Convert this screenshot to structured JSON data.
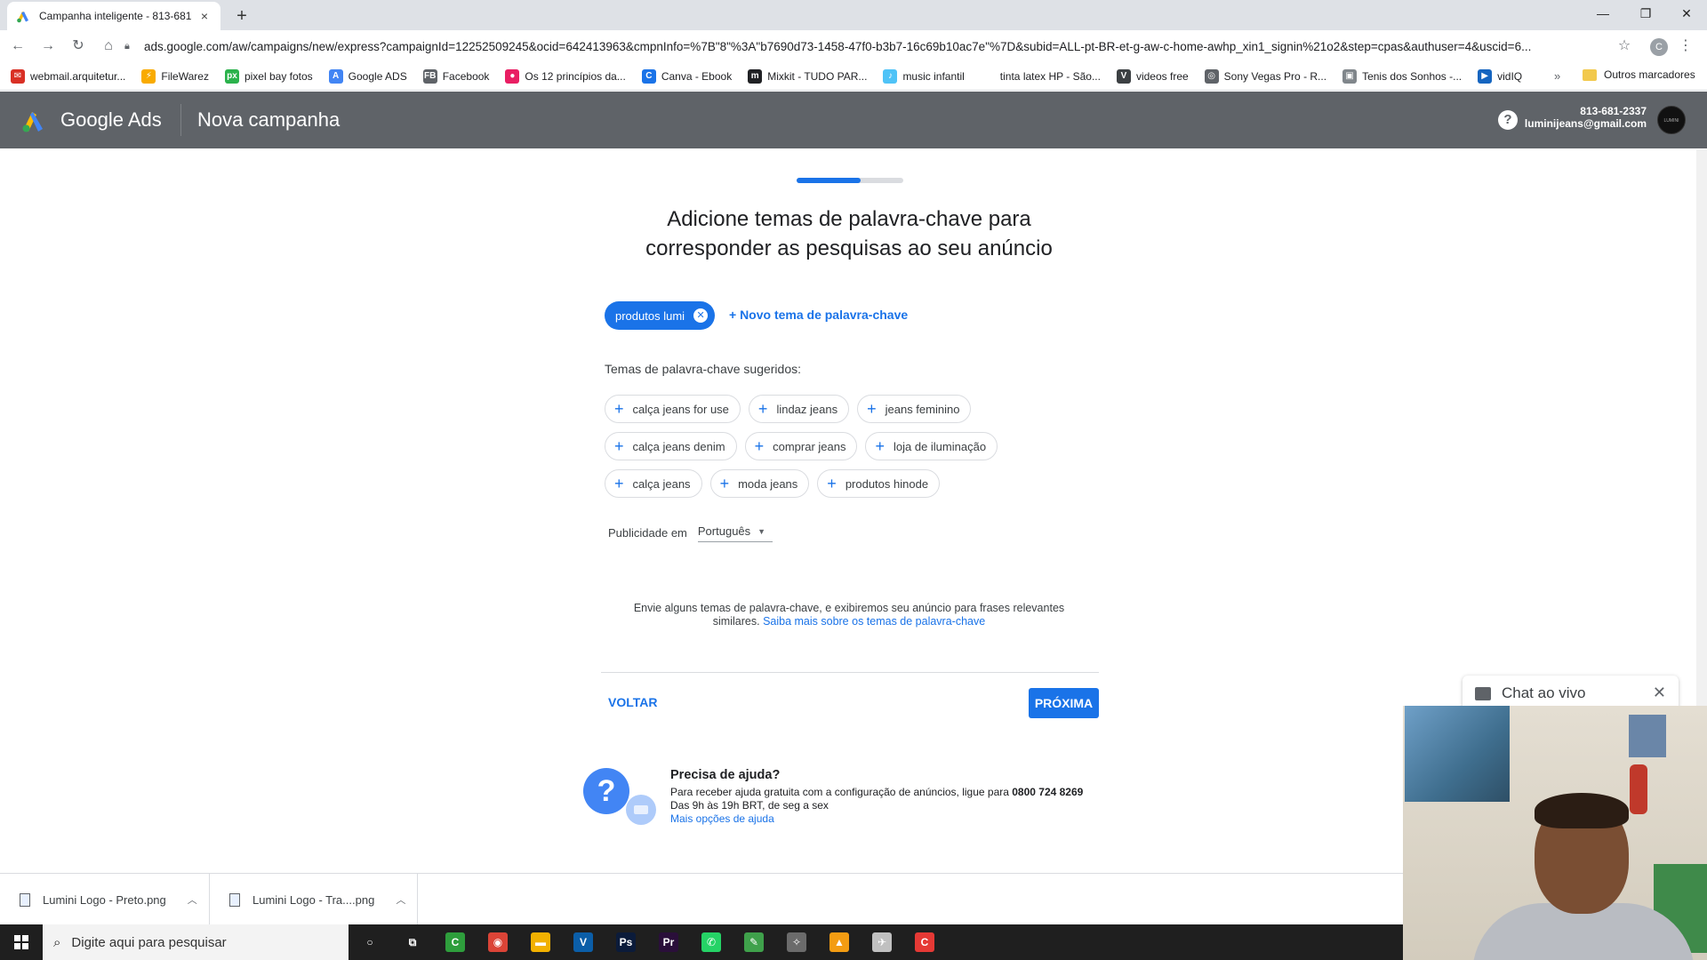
{
  "browser": {
    "tab_title": "Campanha inteligente - 813-681",
    "tab_close": "×",
    "new_tab": "+",
    "url": "ads.google.com/aw/campaigns/new/express?campaignId=12252509245&ocid=642413963&cmpnInfo=%7B\"8\"%3A\"b7690d73-1458-47f0-b3b7-16c69b10ac7e\"%7D&subid=ALL-pt-BR-et-g-aw-c-home-awhp_xin1_signin%21o2&step=cpas&authuser=4&uscid=6...",
    "profile_initial": "C",
    "bookmarks": [
      {
        "label": "webmail.arquitetur...",
        "color": "#d93025",
        "glyph": "✉"
      },
      {
        "label": "FileWarez",
        "color": "#f9ab00",
        "glyph": "⚡"
      },
      {
        "label": "pixel bay fotos",
        "color": "#2bb24c",
        "glyph": "px"
      },
      {
        "label": "Google ADS",
        "color": "#4285f4",
        "glyph": "A"
      },
      {
        "label": "Facebook",
        "color": "#5f6368",
        "glyph": "FB"
      },
      {
        "label": "Os 12 princípios da...",
        "color": "#e91e63",
        "glyph": "●"
      },
      {
        "label": "Canva - Ebook",
        "color": "#1a73e8",
        "glyph": "C"
      },
      {
        "label": "Mixkit - TUDO PAR...",
        "color": "#202124",
        "glyph": "m"
      },
      {
        "label": "music infantil",
        "color": "#4fc3f7",
        "glyph": "♪"
      },
      {
        "label": "tinta latex HP - São...",
        "color": "#ffffff",
        "glyph": ""
      },
      {
        "label": "videos free",
        "color": "#3c4043",
        "glyph": "V"
      },
      {
        "label": "Sony Vegas Pro - R...",
        "color": "#5f6368",
        "glyph": "◎"
      },
      {
        "label": "Tenis dos Sonhos -...",
        "color": "#80868b",
        "glyph": "▣"
      },
      {
        "label": "vidIQ",
        "color": "#1565c0",
        "glyph": "▶"
      }
    ],
    "bookmarks_more": "»",
    "bookmarks_other": "Outros marcadores"
  },
  "header": {
    "product": "Google Ads",
    "page": "Nova campanha",
    "help": "?",
    "account_id": "813-681-2337",
    "account_email": "luminijeans@gmail.com",
    "avatar_text": "LUMINI"
  },
  "wizard": {
    "progress_fraction": 0.6,
    "headline_1": "Adicione temas de palavra-chave para",
    "headline_2": "corresponder as pesquisas ao seu anúncio",
    "selected_theme": "produtos lumi",
    "add_theme": "+ Novo tema de palavra-chave",
    "suggested_label": "Temas de palavra-chave sugeridos:",
    "suggestions": [
      [
        "calça jeans for use",
        "lindaz jeans",
        "jeans feminino"
      ],
      [
        "calça jeans denim",
        "comprar jeans",
        "loja de iluminação"
      ],
      [
        "calça jeans",
        "moda jeans",
        "produtos hinode"
      ]
    ],
    "language_label": "Publicidade em",
    "language_value": "Português",
    "info_text": "Envie alguns temas de palavra-chave, e exibiremos seu anúncio para frases relevantes similares.",
    "info_link": "Saiba mais sobre os temas de palavra-chave",
    "back": "VOLTAR",
    "next": "PRÓXIMA"
  },
  "help": {
    "title": "Precisa de ajuda?",
    "line1": "Para receber ajuda gratuita com a configuração de anúncios, ligue para",
    "phone": "0800 724 8269",
    "line2": "Das 9h às 19h BRT, de seg a sex",
    "link": "Mais opções de ajuda"
  },
  "chat": {
    "label": "Chat ao vivo",
    "close": "✕"
  },
  "downloads": [
    {
      "name": "Lumini Logo - Preto.png"
    },
    {
      "name": "Lumini Logo - Tra....png"
    }
  ],
  "taskbar": {
    "search_placeholder": "Digite aqui para pesquisar",
    "apps": [
      {
        "name": "cortana",
        "glyph": "○",
        "color": "transparent"
      },
      {
        "name": "task-view",
        "glyph": "⧉",
        "color": "transparent"
      },
      {
        "name": "camtasia",
        "glyph": "C",
        "color": "#2e9e3c"
      },
      {
        "name": "chrome",
        "glyph": "◉",
        "color": "#db4437"
      },
      {
        "name": "file-explorer",
        "glyph": "▬",
        "color": "#f2b100"
      },
      {
        "name": "vegas",
        "glyph": "V",
        "color": "#0b5ea8"
      },
      {
        "name": "photoshop",
        "glyph": "Ps",
        "color": "#0b1b3a"
      },
      {
        "name": "premiere",
        "glyph": "Pr",
        "color": "#2a0f3a"
      },
      {
        "name": "whatsapp",
        "glyph": "✆",
        "color": "#25d366"
      },
      {
        "name": "green-app",
        "glyph": "✎",
        "color": "#3fa14b"
      },
      {
        "name": "tool-app",
        "glyph": "✧",
        "color": "#6b6b6b"
      },
      {
        "name": "vlc",
        "glyph": "▲",
        "color": "#f39c12"
      },
      {
        "name": "rocket-app",
        "glyph": "✈",
        "color": "#c0c0c0"
      },
      {
        "name": "camtasia-recorder",
        "glyph": "C",
        "color": "#e53935"
      }
    ]
  }
}
